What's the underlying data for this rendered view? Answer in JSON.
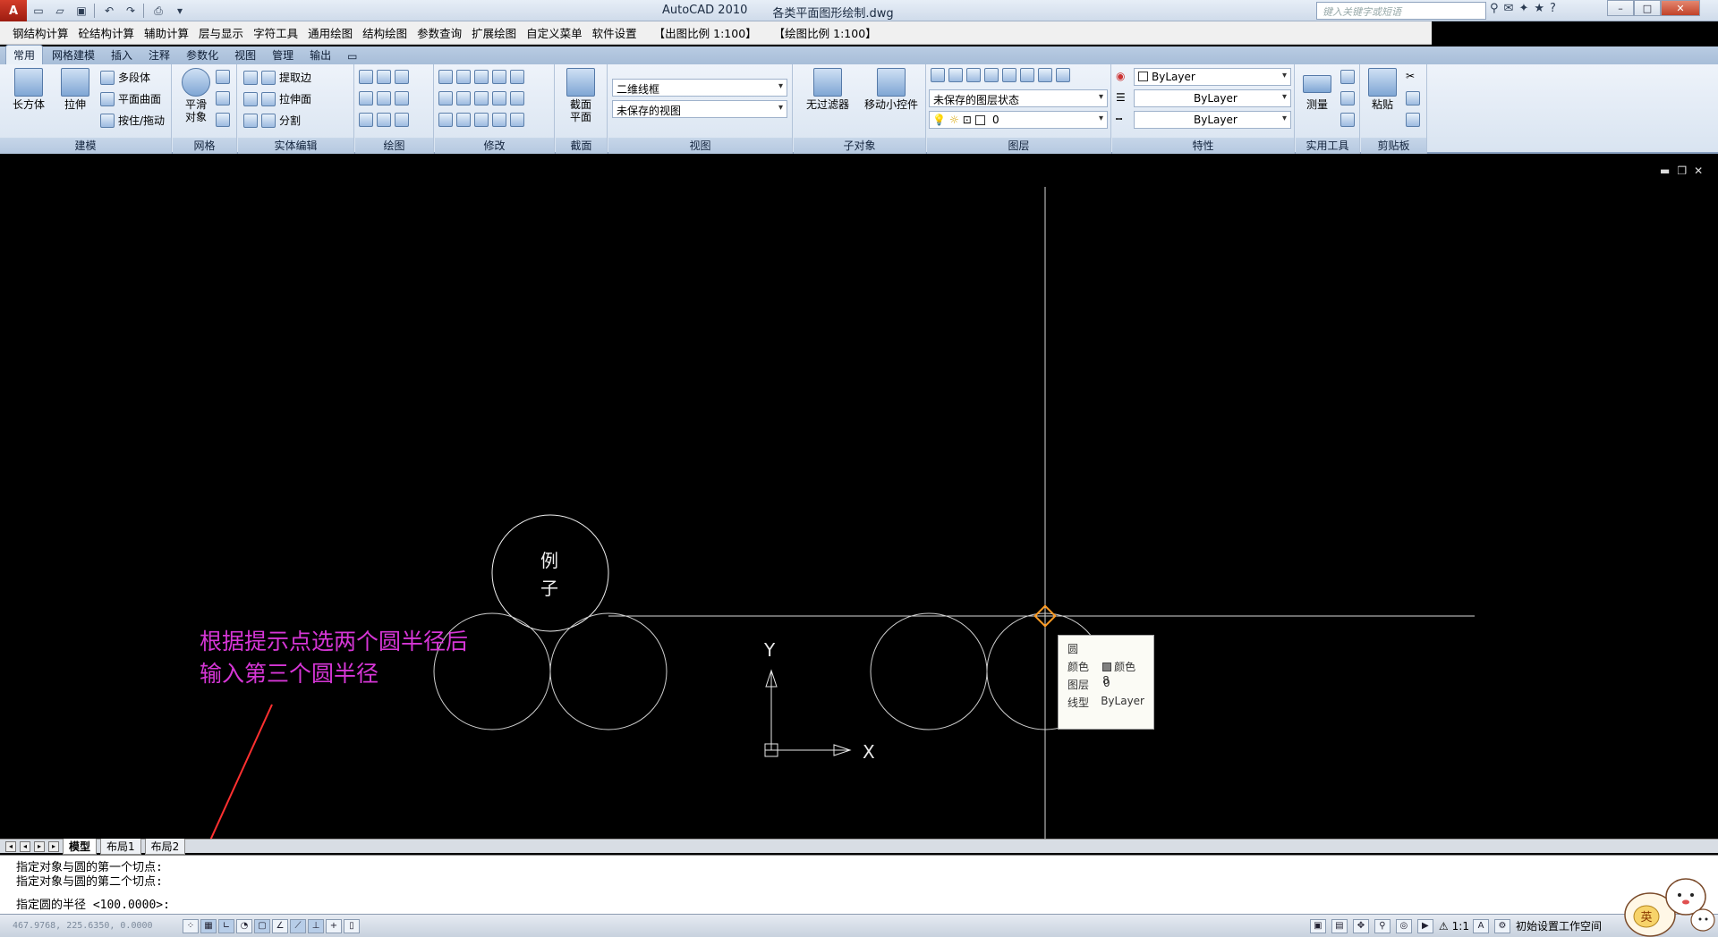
{
  "window": {
    "app_title": "AutoCAD 2010",
    "file_name": "各类平面图形绘制.dwg",
    "search_placeholder": "键入关键字或短语"
  },
  "menubar": [
    "钢结构计算",
    "砼结构计算",
    "辅助计算",
    "层与显示",
    "字符工具",
    "通用绘图",
    "结构绘图",
    "参数查询",
    "扩展绘图",
    "自定义菜单",
    "软件设置",
    "【出图比例 1:100】",
    "【绘图比例 1:100】"
  ],
  "tabs": [
    "常用",
    "网格建模",
    "插入",
    "注释",
    "参数化",
    "视图",
    "管理",
    "输出"
  ],
  "active_tab": "常用",
  "ribbon": {
    "modeling": {
      "title": "建模",
      "box": "长方体",
      "extrude": "拉伸",
      "polysolid": "多段体",
      "planar": "平面曲面",
      "presspull": "按住/拖动"
    },
    "mesh": {
      "title": "网格",
      "smooth": "平滑\n对象"
    },
    "solid_edit": {
      "title": "实体编辑",
      "extract": "提取边",
      "extrude_face": "拉伸面",
      "separate": "分割"
    },
    "draw": {
      "title": "绘图"
    },
    "modify": {
      "title": "修改"
    },
    "section": {
      "title": "截面",
      "plane": "截面\n平面"
    },
    "view": {
      "title": "视图",
      "visual_style": "二维线框",
      "saved_view": "未保存的视图"
    },
    "subobject": {
      "title": "子对象",
      "no_filter": "无过滤器",
      "gizmo": "移动小控件"
    },
    "layers": {
      "title": "图层",
      "layer_state": "未保存的图层状态",
      "current_layer": "0"
    },
    "properties": {
      "title": "特性",
      "color": "ByLayer",
      "linetype": "ByLayer",
      "lineweight": "ByLayer"
    },
    "utilities": {
      "title": "实用工具",
      "measure": "测量"
    },
    "clipboard": {
      "title": "剪贴板",
      "paste": "粘贴"
    }
  },
  "drawing": {
    "circle_label_1": "例",
    "circle_label_2": "子",
    "annotation": "根据提示点选两个圆半径后\n输入第三个圆半径",
    "ucs_x": "X",
    "ucs_y": "Y"
  },
  "tooltip": {
    "title": "圆",
    "rows": [
      {
        "key": "颜色",
        "value": "颜色 8"
      },
      {
        "key": "图层",
        "value": "0"
      },
      {
        "key": "线型",
        "value": "ByLayer"
      }
    ]
  },
  "layout_tabs": [
    "模型",
    "布局1",
    "布局2"
  ],
  "command_lines": [
    "指定对象与圆的第一个切点:",
    "指定对象与圆的第二个切点:",
    "指定圆的半径 <100.0000>:"
  ],
  "status": {
    "coords": "467.9768, 225.6350, 0.0000",
    "scale": "1:1",
    "workspace": "初始设置工作空间"
  },
  "mascot_text": "英"
}
